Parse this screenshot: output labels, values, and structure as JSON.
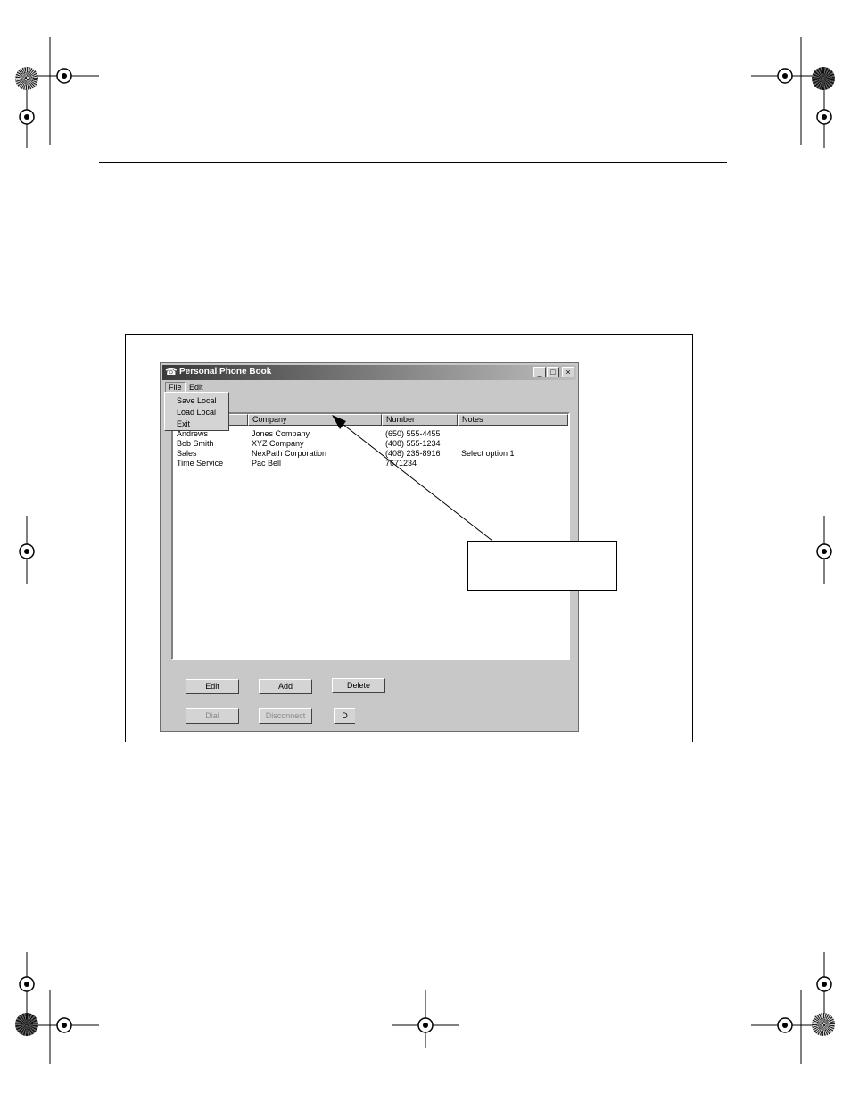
{
  "window": {
    "title": "Personal Phone Book",
    "controls": {
      "minimize": "_",
      "maximize": "□",
      "close": "×"
    }
  },
  "menubar": {
    "items": [
      {
        "label": "File"
      },
      {
        "label": "Edit"
      }
    ]
  },
  "file_menu": {
    "items": [
      {
        "label": "Save Local"
      },
      {
        "label": "Load Local"
      },
      {
        "label": "Exit"
      }
    ]
  },
  "table": {
    "columns": [
      "",
      "Company",
      "Number",
      "Notes"
    ],
    "rows": [
      [
        "Andrews",
        "Jones Company",
        "(650) 555-4455",
        ""
      ],
      [
        "Bob Smith",
        "XYZ Company",
        "(408) 555-1234",
        ""
      ],
      [
        "Sales",
        "NexPath Corporation",
        "(408) 235-8916",
        "Select option 1"
      ],
      [
        "Time Service",
        "Pac Bell",
        "7671234",
        ""
      ]
    ]
  },
  "buttons": {
    "edit": "Edit",
    "add": "Add",
    "delete": "Delete",
    "dial": "Dial",
    "disconnect": "Disconnect",
    "partial": "D"
  },
  "icons": {
    "app": "phone-book-icon",
    "registration": "crosshair-registration-icon",
    "color_wheel": "color-wheel-icon"
  }
}
